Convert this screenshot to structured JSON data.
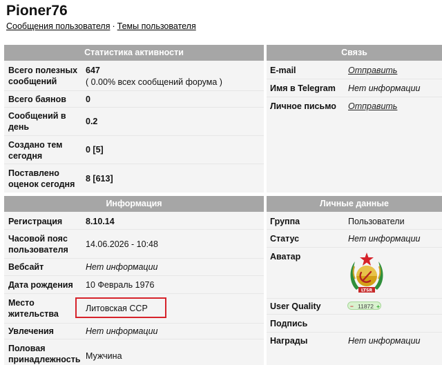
{
  "profile": {
    "username": "Pioner76",
    "links": [
      "Сообщения пользователя",
      "Темы пользователя"
    ],
    "link_separator": "·"
  },
  "activity": {
    "title": "Статистика активности",
    "rows": [
      {
        "label": "Всего полезных сообщений",
        "value": "647",
        "value_note": "( 0.00% всех сообщений форума )"
      },
      {
        "label": "Всего баянов",
        "value": "0"
      },
      {
        "label": "Сообщений в день",
        "value": "0.2"
      },
      {
        "label": "Создано тем сегодня",
        "value": "0 [5]"
      },
      {
        "label": "Поставлено оценок сегодня",
        "value": "8 [613]"
      }
    ]
  },
  "contact": {
    "title": "Связь",
    "rows": [
      {
        "label": "E-mail",
        "value": "Отправить"
      },
      {
        "label": "Имя в Telegram",
        "value": "Нет информации"
      },
      {
        "label": "Личное письмо",
        "value": "Отправить"
      }
    ]
  },
  "info": {
    "title": "Информация",
    "rows": [
      {
        "label": "Регистрация",
        "value": "8.10.14"
      },
      {
        "label": "Часовой пояс пользователя",
        "value": "14.06.2026 - 10:48"
      },
      {
        "label": "Вебсайт",
        "value": "Нет информации"
      },
      {
        "label": "Дата рождения",
        "value": "10 Февраль 1976"
      },
      {
        "label": "Место жительства",
        "value": "Литовская ССР"
      },
      {
        "label": "Увлечения",
        "value": "Нет информации"
      },
      {
        "label": "Половая принадлежность",
        "value": "Мужчина"
      }
    ]
  },
  "personal": {
    "title": "Личные данные",
    "rows": [
      {
        "label": "Группа",
        "value": "Пользователи"
      },
      {
        "label": "Статус",
        "value": "Нет информации"
      },
      {
        "label": "Аватар",
        "avatar_text": "LTSR",
        "avatar_icon": "lithuanian-ssr-emblem"
      },
      {
        "label": "User Quality",
        "minus": "−",
        "value": "11872",
        "plus": "+"
      },
      {
        "label": "Подпись"
      },
      {
        "label": "Награды",
        "value": "Нет информации"
      }
    ]
  },
  "colors": {
    "panel_header": "#a6a6a6",
    "panel_bg": "#f4f4f4",
    "highlight": "#d6222a",
    "quality_badge": "#d9f2cf"
  }
}
